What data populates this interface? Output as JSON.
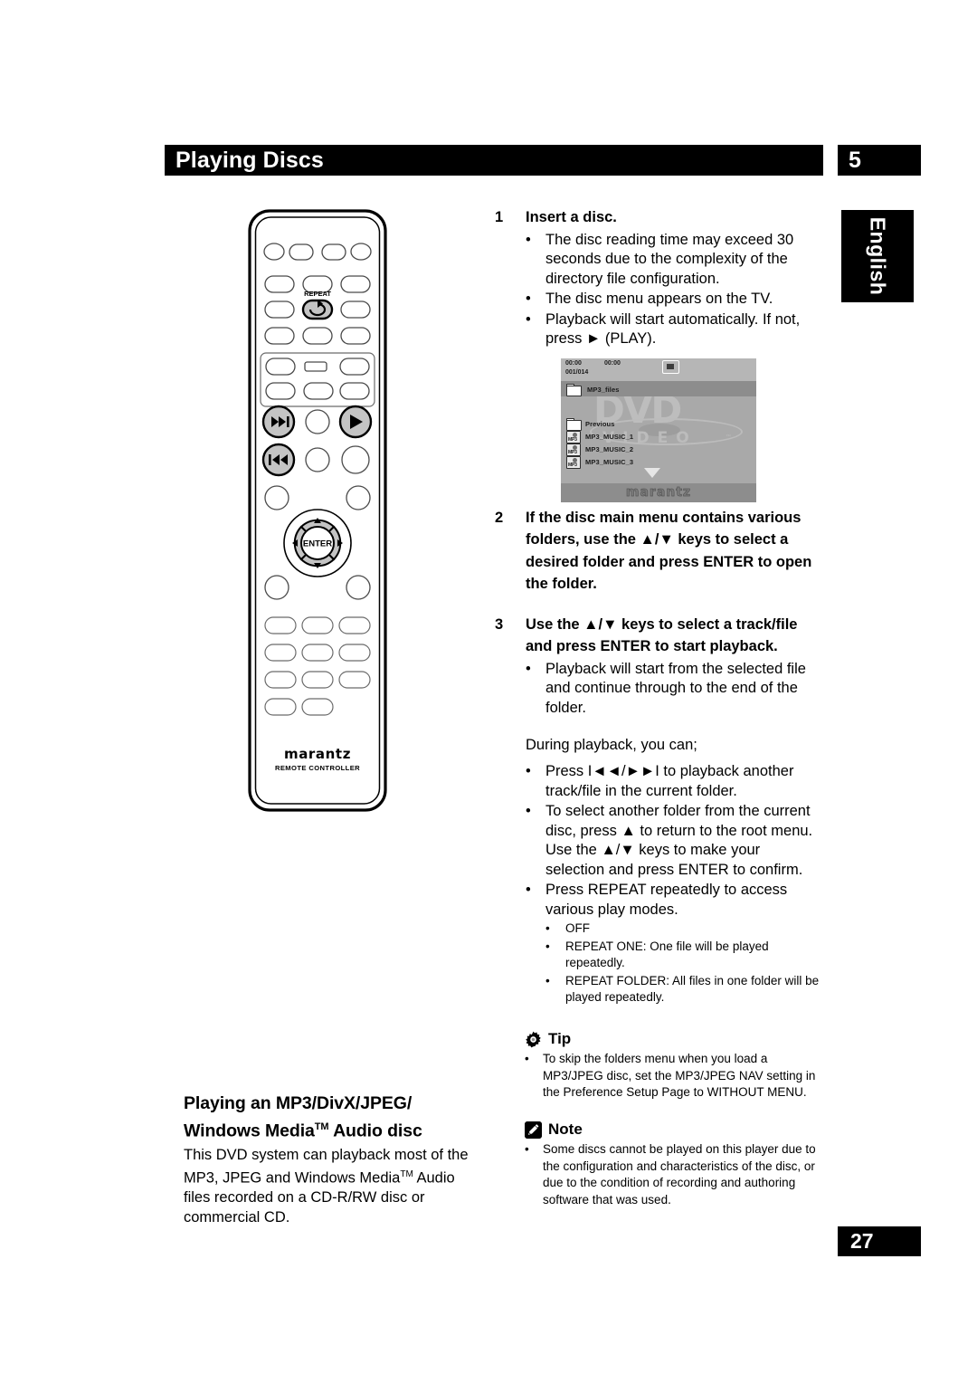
{
  "header": {
    "title": "Playing Discs",
    "chapter_number": "5"
  },
  "language_tab": "English",
  "page_number": "27",
  "remote": {
    "repeat_label": "REPEAT",
    "enter_label": "ENTER",
    "brand": "marantz",
    "subtitle": "REMOTE CONTROLLER"
  },
  "tv_screen": {
    "time_elapsed": "00:00",
    "time_total": "00:00",
    "track_counter": "001/014",
    "current_folder": "MP3_files",
    "items": [
      {
        "icon": "folder-icon",
        "label": "Previous"
      },
      {
        "icon": "mp3-file-icon",
        "label": "MP3_MUSIC_1"
      },
      {
        "icon": "mp3-file-icon",
        "label": "MP3_MUSIC_2"
      },
      {
        "icon": "mp3-file-icon",
        "label": "MP3_MUSIC_3"
      }
    ],
    "watermark_primary": "DVD",
    "watermark_secondary": "VIDEO",
    "brand": "marantz",
    "stop_icon": "stop-icon",
    "scroll_icon": "down-arrow-icon"
  },
  "steps": [
    {
      "number": "1",
      "title": "Insert a disc.",
      "bullets": [
        "The disc reading time may exceed 30 seconds due to the complexity of the directory file configuration.",
        "The disc menu appears on the TV.",
        "Playback will start automatically. If not, press ► (PLAY)."
      ]
    },
    {
      "number": "2",
      "title": "If the disc main menu contains various folders, use the ▲/▼ keys to select a desired folder and press ENTER to open the folder.",
      "bullets": []
    },
    {
      "number": "3",
      "title": "Use the ▲/▼ keys to select a track/file and press ENTER to start playback.",
      "bullets": [
        "Playback will start from the selected file and continue through to the end of the folder."
      ]
    }
  ],
  "during_playback": {
    "intro": "During playback, you can;",
    "bullets": [
      "Press I◄◄/►►I to playback another track/file in the current folder.",
      "To select another folder from the current disc, press ▲ to return to the root menu. Use the ▲/▼ keys to make your selection and press ENTER to confirm.",
      "Press REPEAT repeatedly to access various play modes."
    ],
    "repeat_modes": [
      "OFF",
      "REPEAT ONE: One file will be played repeatedly.",
      "REPEAT FOLDER: All files in one folder will be played repeatedly."
    ]
  },
  "tip": {
    "icon": "gear-icon",
    "heading": "Tip",
    "items": [
      "To skip the folders menu when you load a MP3/JPEG disc, set the MP3/JPEG NAV setting in the Preference Setup Page to WITHOUT MENU."
    ]
  },
  "note": {
    "icon": "pencil-icon",
    "heading": "Note",
    "items": [
      "Some discs cannot be played on this player due to the configuration and characteristics of the disc, or due to the condition of recording and authoring software that was used."
    ]
  },
  "section": {
    "heading_line1": "Playing an MP3/DivX/JPEG/",
    "heading_line2_a": "Windows Media",
    "heading_tm": "TM",
    "heading_line2_b": " Audio disc",
    "body_a": "This DVD system can playback most of the MP3, JPEG and Windows Media",
    "body_tm": "TM",
    "body_b": " Audio files recorded on a CD-R/RW disc or commercial CD."
  },
  "colors": {
    "ink": "#000000",
    "paper": "#ffffff",
    "screen_bg": "#a9a9a9",
    "button_fill": "#c4c4c4"
  }
}
